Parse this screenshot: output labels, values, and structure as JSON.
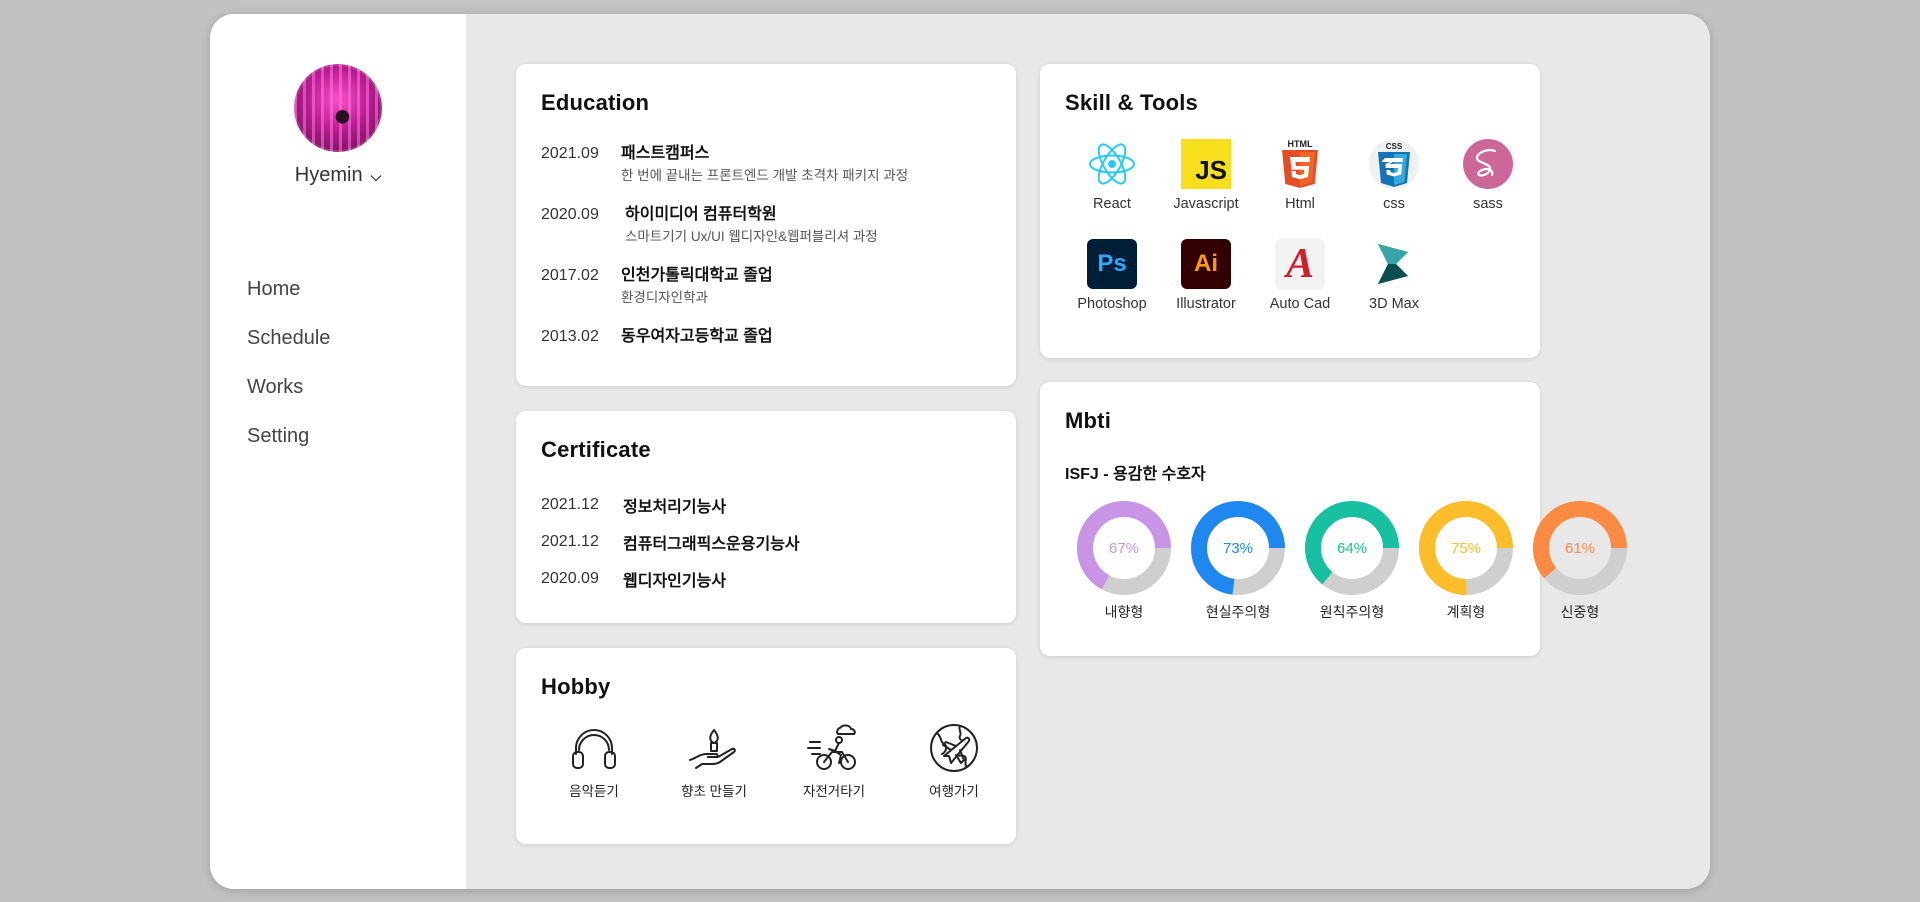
{
  "profile": {
    "name": "Hyemin"
  },
  "nav": [
    "Home",
    "Schedule",
    "Works",
    "Setting"
  ],
  "education": {
    "title": "Education",
    "items": [
      {
        "date": "2021.09",
        "name": "패스트캠퍼스",
        "desc": "한 번에 끝내는 프론트엔드 개발 초격차 패키지 과정"
      },
      {
        "date": "2020.09",
        "name": "하이미디어 컴퓨터학원",
        "desc": "스마트기기 Ux/UI 웹디자인&웹퍼블리셔 과정"
      },
      {
        "date": "2017.02",
        "name": "인천가톨릭대학교 졸업",
        "desc": "환경디자인학과"
      },
      {
        "date": "2013.02",
        "name": "동우여자고등학교 졸업",
        "desc": ""
      }
    ]
  },
  "certificate": {
    "title": "Certificate",
    "items": [
      {
        "date": "2021.12",
        "name": "정보처리기능사"
      },
      {
        "date": "2021.12",
        "name": "컴퓨터그래픽스운용기능사"
      },
      {
        "date": "2020.09",
        "name": "웹디자인기능사"
      }
    ]
  },
  "hobby": {
    "title": "Hobby",
    "items": [
      {
        "label": "음악듣기",
        "icon": "headphones-icon"
      },
      {
        "label": "향초 만들기",
        "icon": "candle-hand-icon"
      },
      {
        "label": "자전거타기",
        "icon": "bicycle-icon"
      },
      {
        "label": "여행가기",
        "icon": "globe-airplane-icon"
      }
    ]
  },
  "skills": {
    "title": "Skill & Tools",
    "items": [
      {
        "label": "React",
        "icon": "react-icon"
      },
      {
        "label": "Javascript",
        "icon": "javascript-icon",
        "mark": "JS"
      },
      {
        "label": "Html",
        "icon": "html5-icon",
        "mark": "HTML"
      },
      {
        "label": "css",
        "icon": "css3-icon",
        "mark": "CSS"
      },
      {
        "label": "sass",
        "icon": "sass-icon"
      },
      {
        "label": "Photoshop",
        "icon": "photoshop-icon",
        "mark": "Ps"
      },
      {
        "label": "Illustrator",
        "icon": "illustrator-icon",
        "mark": "Ai"
      },
      {
        "label": "Auto Cad",
        "icon": "autocad-icon",
        "mark": "A"
      },
      {
        "label": "3D Max",
        "icon": "3dsmax-icon"
      }
    ]
  },
  "mbti": {
    "title": "Mbti",
    "type": "ISFJ - 용감한 수호자",
    "traits": [
      {
        "label": "내향형",
        "percent": 67,
        "display": "67%",
        "color": "#c894e6"
      },
      {
        "label": "현실주의형",
        "percent": 73,
        "display": "73%",
        "color": "#1e88f0"
      },
      {
        "label": "원칙주의형",
        "percent": 64,
        "display": "64%",
        "color": "#17c0a0"
      },
      {
        "label": "계획형",
        "percent": 75,
        "display": "75%",
        "color": "#fbbd2a"
      },
      {
        "label": "신중형",
        "percent": 61,
        "display": "61%",
        "color": "#fb8a43"
      }
    ],
    "track_color": "#cfcfcf"
  }
}
